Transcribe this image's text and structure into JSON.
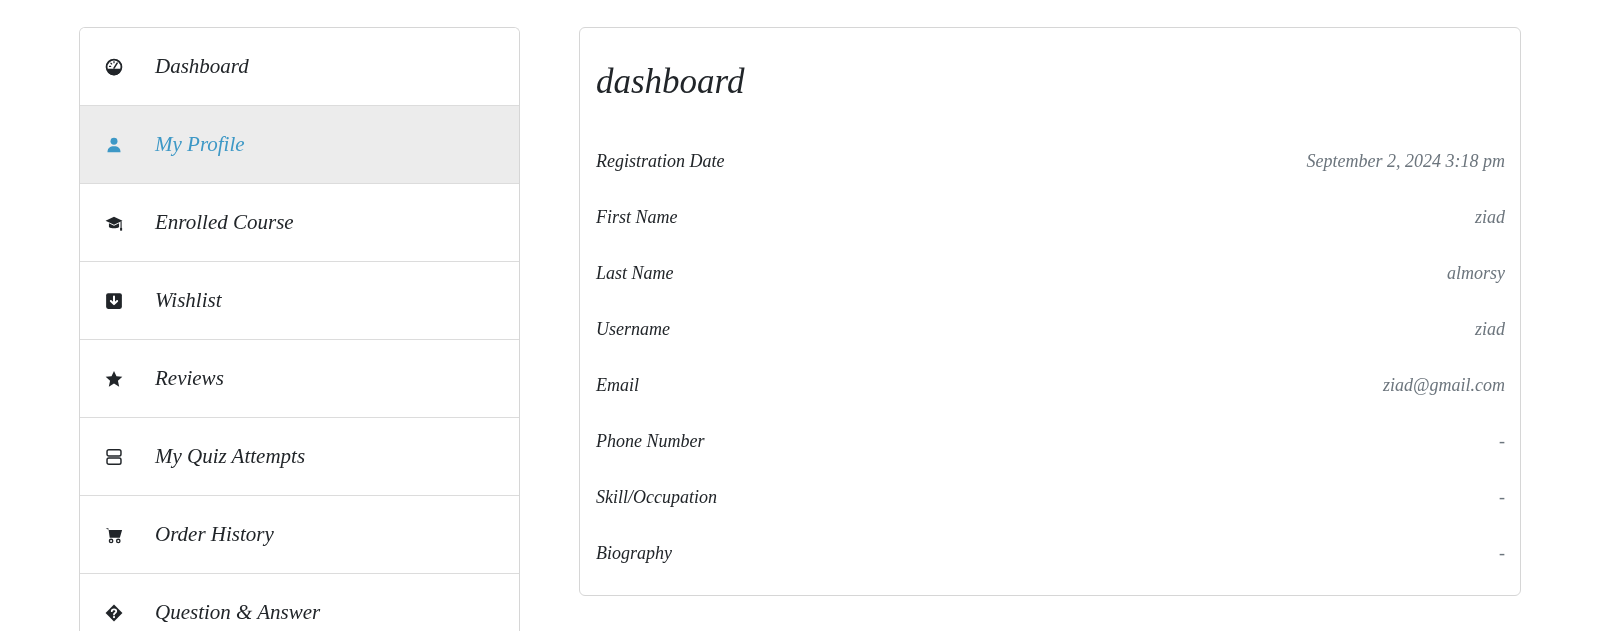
{
  "sidebar": {
    "items": [
      {
        "label": "Dashboard",
        "selected": false
      },
      {
        "label": "My Profile",
        "selected": true
      },
      {
        "label": "Enrolled Course",
        "selected": false
      },
      {
        "label": "Wishlist",
        "selected": false
      },
      {
        "label": "Reviews",
        "selected": false
      },
      {
        "label": "My Quiz Attempts",
        "selected": false
      },
      {
        "label": "Order History",
        "selected": false
      },
      {
        "label": "Question & Answer",
        "selected": false
      }
    ]
  },
  "panel": {
    "title": "dashboard",
    "fields": [
      {
        "label": "Registration Date",
        "value": "September 2, 2024 3:18 pm"
      },
      {
        "label": "First Name",
        "value": "ziad"
      },
      {
        "label": "Last Name",
        "value": "almorsy"
      },
      {
        "label": "Username",
        "value": "ziad"
      },
      {
        "label": "Email",
        "value": "ziad@gmail.com"
      },
      {
        "label": "Phone Number",
        "value": "-"
      },
      {
        "label": "Skill/Occupation",
        "value": "-"
      },
      {
        "label": "Biography",
        "value": "-"
      }
    ]
  }
}
